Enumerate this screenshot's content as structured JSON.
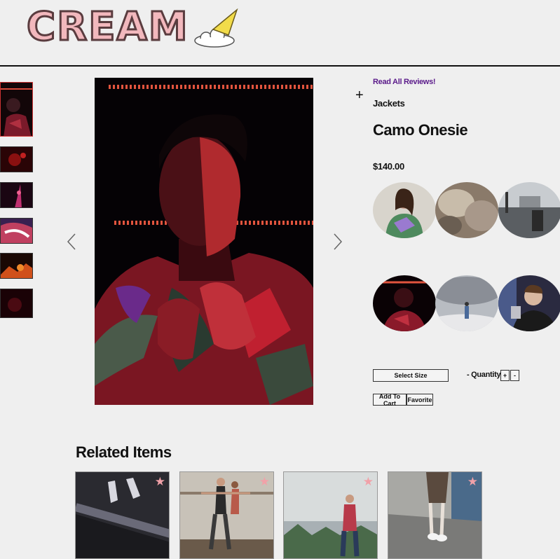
{
  "brand": {
    "name": "CREAM"
  },
  "product": {
    "reviews_link": "Read All Reviews!",
    "category": "Jackets",
    "title": "Camo Onesie",
    "price": "$140.00"
  },
  "controls": {
    "select_size": "Select Size",
    "quantity_label": "- Quantity 0",
    "increment": "+",
    "decrement": "-",
    "add_to_cart": "Add To Cart",
    "favorite": "Favorite"
  },
  "icons": {
    "plus": "+",
    "prev": "chevron-left-icon",
    "next": "chevron-right-icon",
    "star": "★"
  },
  "related": {
    "title": "Related Items"
  },
  "colors": {
    "accent_pink": "#f1a1a8",
    "link_purple": "#5a1a8a",
    "background": "#efefef"
  }
}
